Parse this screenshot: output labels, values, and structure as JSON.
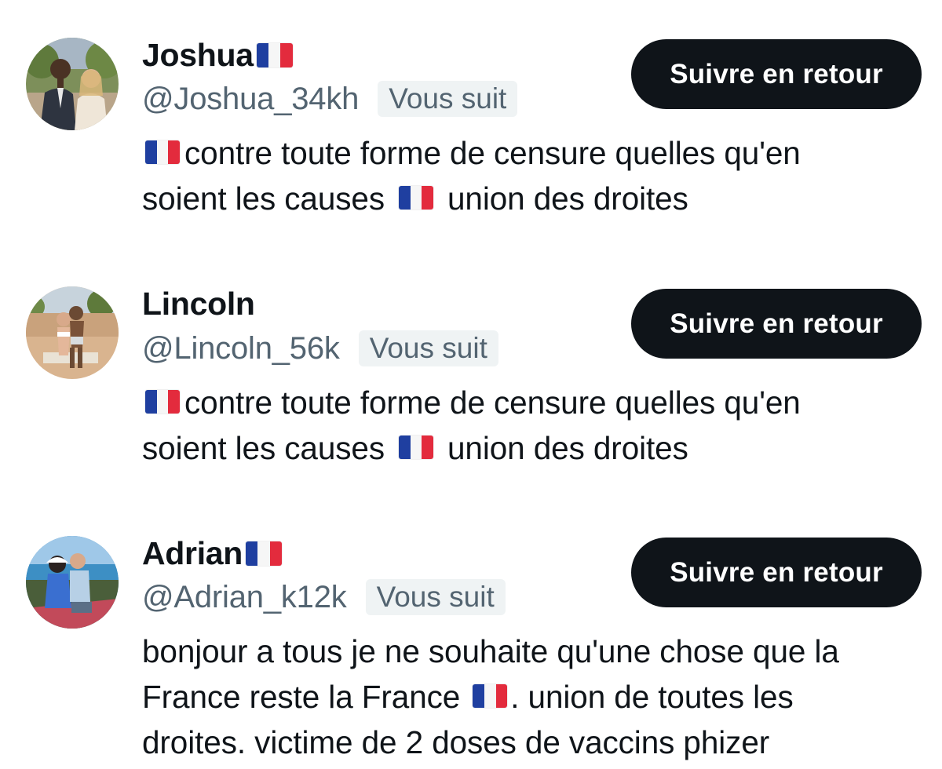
{
  "accounts": [
    {
      "name": "Joshua",
      "name_flag": true,
      "handle": "@Joshua_34kh",
      "badge": "Vous suit",
      "follow_label": "Suivre en retour",
      "bio_lines": [
        [
          "flag",
          "contre toute forme de censure quelles qu'en"
        ],
        [
          "soient les causes",
          "flag",
          "union des droites"
        ]
      ]
    },
    {
      "name": "Lincoln",
      "name_flag": false,
      "handle": "@Lincoln_56k",
      "badge": "Vous suit",
      "follow_label": "Suivre en retour",
      "bio_lines": [
        [
          "flag",
          "contre toute forme de censure quelles qu'en"
        ],
        [
          "soient les causes",
          "flag",
          "union des droites"
        ]
      ]
    },
    {
      "name": "Adrian",
      "name_flag": true,
      "handle": "@Adrian_k12k",
      "badge": "Vous suit",
      "follow_label": "Suivre en retour",
      "bio_lines": [
        [
          "bonjour a tous je ne souhaite qu'une chose que la"
        ],
        [
          "France reste la France",
          "flag",
          ". union de toutes les"
        ],
        [
          "droites. victime de 2 doses de vaccins phizer"
        ]
      ]
    }
  ],
  "colors": {
    "text": "#0f1419",
    "secondary": "#536471",
    "button_bg": "#0f1419",
    "badge_bg": "#eff3f4",
    "flag_blue": "#1f3fa0",
    "flag_red": "#e32b3d"
  }
}
